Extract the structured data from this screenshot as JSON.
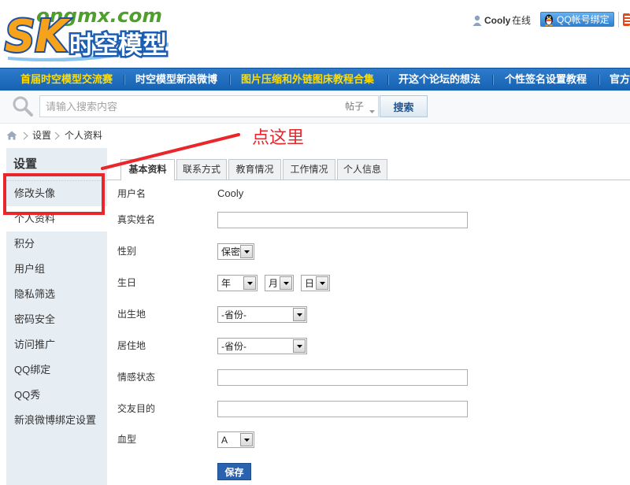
{
  "logo": {
    "domain": "ongmx.com",
    "mark": "SK",
    "name": "时空模型"
  },
  "user_bar": {
    "username": "Cooly",
    "status": "在线",
    "qq_bind_label": "QQ帐号绑定"
  },
  "nav": {
    "items": [
      {
        "label": "首届时空模型交流赛",
        "highlight": true
      },
      {
        "label": "时空模型新浪微博",
        "highlight": false
      },
      {
        "label": "图片压缩和外链图床教程合集",
        "highlight": true
      },
      {
        "label": "开这个论坛的想法",
        "highlight": false
      },
      {
        "label": "个性签名设置教程",
        "highlight": false
      },
      {
        "label": "官方",
        "highlight": false
      }
    ]
  },
  "search": {
    "placeholder": "请输入搜索内容",
    "scope": "帖子",
    "button_label": "搜索"
  },
  "breadcrumb": {
    "items": [
      "设置",
      "个人资料"
    ]
  },
  "annotation": {
    "text": "点这里"
  },
  "sidebar": {
    "title": "设置",
    "items": [
      {
        "label": "修改头像"
      },
      {
        "label": "个人资料",
        "active": true
      },
      {
        "label": "积分"
      },
      {
        "label": "用户组"
      },
      {
        "label": "隐私筛选"
      },
      {
        "label": "密码安全"
      },
      {
        "label": "访问推广"
      },
      {
        "label": "QQ绑定"
      },
      {
        "label": "QQ秀"
      },
      {
        "label": "新浪微博绑定设置"
      }
    ]
  },
  "tabs": [
    {
      "label": "基本资料",
      "active": true
    },
    {
      "label": "联系方式"
    },
    {
      "label": "教育情况"
    },
    {
      "label": "工作情况"
    },
    {
      "label": "个人信息"
    }
  ],
  "form": {
    "username": {
      "label": "用户名",
      "value": "Cooly"
    },
    "realname": {
      "label": "真实姓名"
    },
    "gender": {
      "label": "性别",
      "selected": "保密"
    },
    "birthday": {
      "label": "生日",
      "year": "年",
      "month": "月",
      "day": "日"
    },
    "birthplace": {
      "label": "出生地",
      "selected": "-省份-"
    },
    "residence": {
      "label": "居住地",
      "selected": "-省份-"
    },
    "affective_status": {
      "label": "情感状态"
    },
    "looking_for": {
      "label": "交友目的"
    },
    "blood_type": {
      "label": "血型",
      "selected": "A"
    },
    "save_label": "保存"
  },
  "icons": [
    "user-icon",
    "qq-penguin-icon",
    "search-icon",
    "chevron-down-icon",
    "home-icon",
    "chevron-right-icon",
    "select-arrow-icon"
  ],
  "colors": {
    "nav_background": "#1b68b8",
    "nav_text": "#ffffff",
    "nav_highlight": "#ffdd00",
    "sidebar_background": "#e6edf3",
    "save_button": "#2b62b0",
    "annotation": "#e8262b"
  }
}
